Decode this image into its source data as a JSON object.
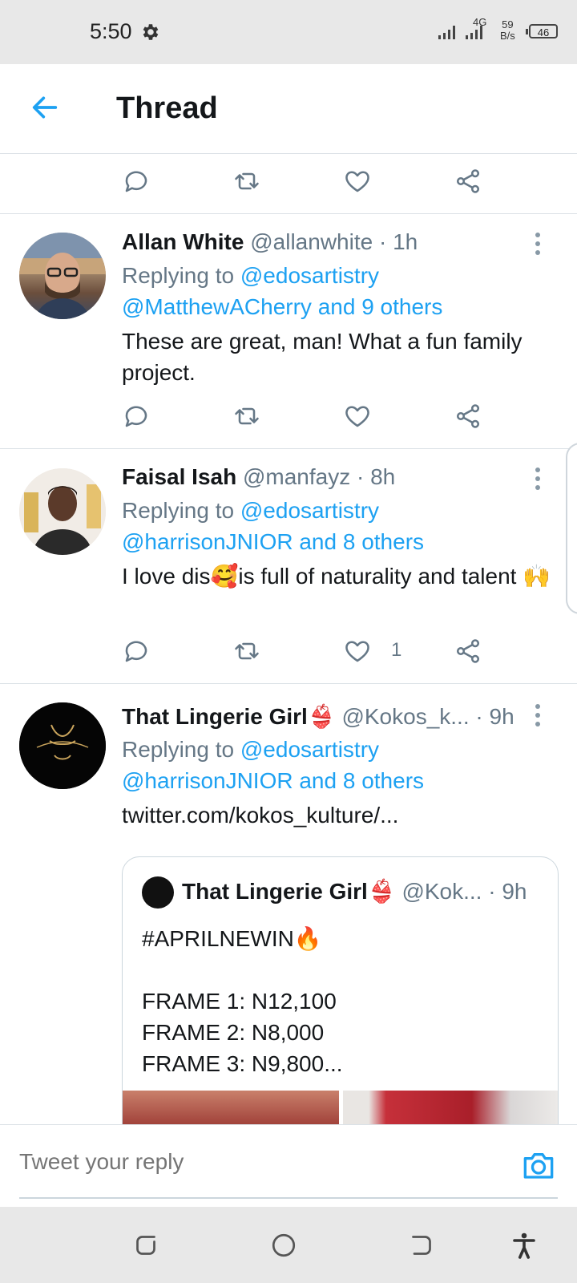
{
  "status_bar": {
    "time": "5:50",
    "network": "4G",
    "speed_value": "59",
    "speed_unit": "B/s",
    "battery": "46",
    "icons": [
      "gear-icon",
      "signal-icon",
      "battery-icon"
    ]
  },
  "header": {
    "title": "Thread",
    "back_icon": "arrow-left-icon"
  },
  "tweets": [
    {
      "name": "Allan White",
      "handle": "@allanwhite",
      "time": "· 1h",
      "replying_prefix": "Replying to ",
      "replying_to": "@edosartistry",
      "replying_others": "@MatthewACherry and 9 others",
      "text": "These are great, man! What a fun family project.",
      "likes": ""
    },
    {
      "name": "Faisal Isah",
      "handle": "@manfayz",
      "time": "· 8h",
      "replying_prefix": "Replying to ",
      "replying_to": "@edosartistry",
      "replying_others": "@harrisonJNIOR and 8 others",
      "text": "I love dis🥰is full of naturality and talent 🙌",
      "likes": "1"
    },
    {
      "name": "That Lingerie Girl👙",
      "handle": "@Kokos_k...",
      "time": "· 9h",
      "replying_prefix": "Replying to ",
      "replying_to": "@edosartistry",
      "replying_others": "@harrisonJNIOR and 8 others",
      "link": "twitter.com/kokos_kulture/...",
      "quote": {
        "name": "That Lingerie Girl👙",
        "handle": "@Kok...",
        "time": "· 9h",
        "text": "#APRILNEWIN🔥\n\nFRAME 1: N12,100\nFRAME 2: N8,000\nFRAME 3: N9,800..."
      }
    }
  ],
  "composer": {
    "placeholder": "Tweet your reply",
    "camera_icon": "camera-icon"
  },
  "colors": {
    "accent": "#1da1f2",
    "text": "#14171a",
    "secondary": "#657786",
    "divider": "#dbe1e6",
    "system_bar": "#e8e8e8"
  }
}
